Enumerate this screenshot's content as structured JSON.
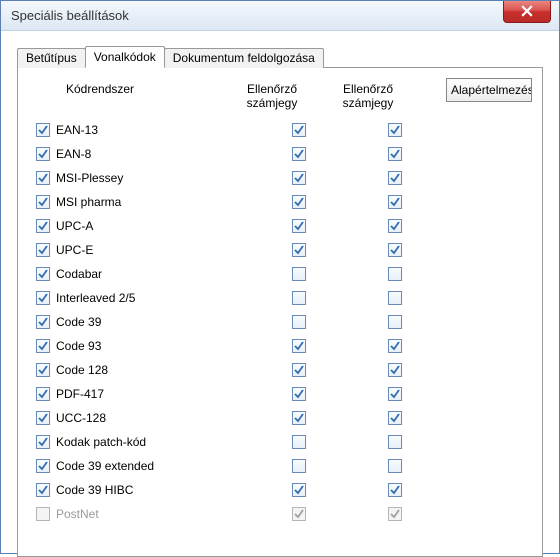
{
  "window": {
    "title": "Speciális beállítások"
  },
  "tabs": [
    {
      "label": "Betűtípus",
      "active": false
    },
    {
      "label": "Vonalkódok",
      "active": true
    },
    {
      "label": "Dokumentum feldolgozása",
      "active": false
    }
  ],
  "defaults_button": "Alapértelmezés",
  "columns": {
    "codesystem": "Kódrendszer",
    "check1": "Ellenőrző számjegy",
    "check2": "Ellenőrző számjegy"
  },
  "rows": [
    {
      "name": "EAN-13",
      "enabled": true,
      "c0": true,
      "c1": true,
      "c2": true
    },
    {
      "name": "EAN-8",
      "enabled": true,
      "c0": true,
      "c1": true,
      "c2": true
    },
    {
      "name": "MSI-Plessey",
      "enabled": true,
      "c0": true,
      "c1": true,
      "c2": true
    },
    {
      "name": "MSI pharma",
      "enabled": true,
      "c0": true,
      "c1": true,
      "c2": true
    },
    {
      "name": "UPC-A",
      "enabled": true,
      "c0": true,
      "c1": true,
      "c2": true
    },
    {
      "name": "UPC-E",
      "enabled": true,
      "c0": true,
      "c1": true,
      "c2": true
    },
    {
      "name": "Codabar",
      "enabled": true,
      "c0": true,
      "c1": false,
      "c2": false
    },
    {
      "name": "Interleaved 2/5",
      "enabled": true,
      "c0": true,
      "c1": false,
      "c2": false
    },
    {
      "name": "Code 39",
      "enabled": true,
      "c0": true,
      "c1": false,
      "c2": false
    },
    {
      "name": "Code 93",
      "enabled": true,
      "c0": true,
      "c1": true,
      "c2": true
    },
    {
      "name": "Code 128",
      "enabled": true,
      "c0": true,
      "c1": true,
      "c2": true
    },
    {
      "name": "PDF-417",
      "enabled": true,
      "c0": true,
      "c1": true,
      "c2": true
    },
    {
      "name": "UCC-128",
      "enabled": true,
      "c0": true,
      "c1": true,
      "c2": true
    },
    {
      "name": "Kodak patch-kód",
      "enabled": true,
      "c0": true,
      "c1": false,
      "c2": false
    },
    {
      "name": "Code 39 extended",
      "enabled": true,
      "c0": true,
      "c1": false,
      "c2": false
    },
    {
      "name": "Code 39 HIBC",
      "enabled": true,
      "c0": true,
      "c1": true,
      "c2": true
    },
    {
      "name": "PostNet",
      "enabled": false,
      "c0": false,
      "c1": true,
      "c2": true
    }
  ]
}
